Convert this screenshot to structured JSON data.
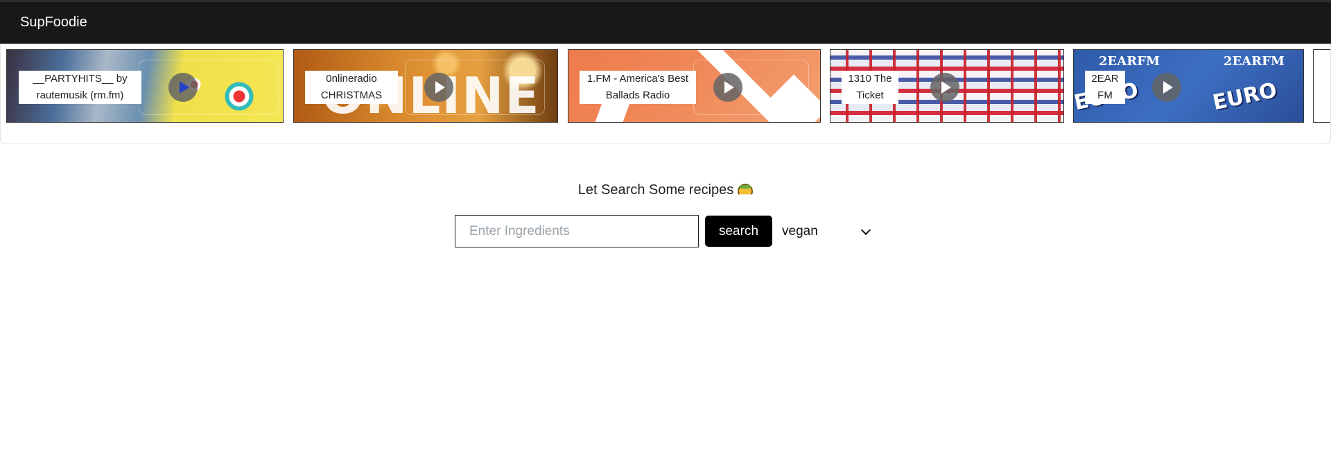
{
  "navbar": {
    "brand": "SupFoodie"
  },
  "stations": [
    {
      "name": "__PARTYHITS__ by rautemusik (rm.fm)",
      "icon": "play-icon",
      "active": true
    },
    {
      "name": "0nlineradio CHRISTMAS",
      "art_text": "ONLINE RADIO",
      "icon": "play-icon"
    },
    {
      "name": "1.FM - America's Best Ballads Radio",
      "icon": "play-icon"
    },
    {
      "name": "1310 The Ticket",
      "icon": "play-icon"
    },
    {
      "name": "2EAR FM",
      "art_logo": "2EARFM",
      "art_text": "EUROBODALLA LIVE!",
      "icon": "play-icon"
    }
  ],
  "search": {
    "heading": "Let Search Some recipes",
    "heading_icon": "taco-icon",
    "placeholder": "Enter Ingredients",
    "value": "",
    "button_label": "search",
    "diet_selected": "vegan",
    "diet_icon": "chevron-down-icon"
  },
  "colors": {
    "navbar_bg": "#181818",
    "button_bg": "#000000",
    "play_active": "#2340c8"
  }
}
